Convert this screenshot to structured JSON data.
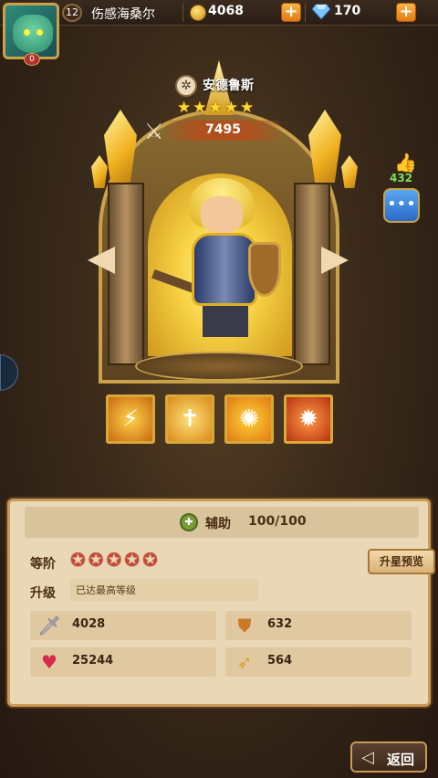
{
  "header": {
    "level": "12",
    "player_name": "伤感海桑尔",
    "vip_level": "0",
    "gold": "4068",
    "diamonds": "170"
  },
  "hero": {
    "name": "安德鲁斯",
    "stars": 5,
    "power": "7495",
    "likes": "432"
  },
  "skills": [
    "skill-1",
    "skill-2",
    "skill-3",
    "skill-4"
  ],
  "info": {
    "class_label": "辅助",
    "class_count": "100/100",
    "rank_label": "等阶",
    "rank_stars": 5,
    "upgrade_label": "升级",
    "upgrade_status": "已达最高等级",
    "preview_button": "升星预览"
  },
  "stats": {
    "attack": "4028",
    "defense": "632",
    "hp": "25244",
    "speed": "564"
  },
  "footer": {
    "back_label": "返回"
  },
  "colors": {
    "accent_gold": "#c9a24a",
    "panel_bg": "#e9d7b6",
    "button_orange": "#e07a14"
  }
}
